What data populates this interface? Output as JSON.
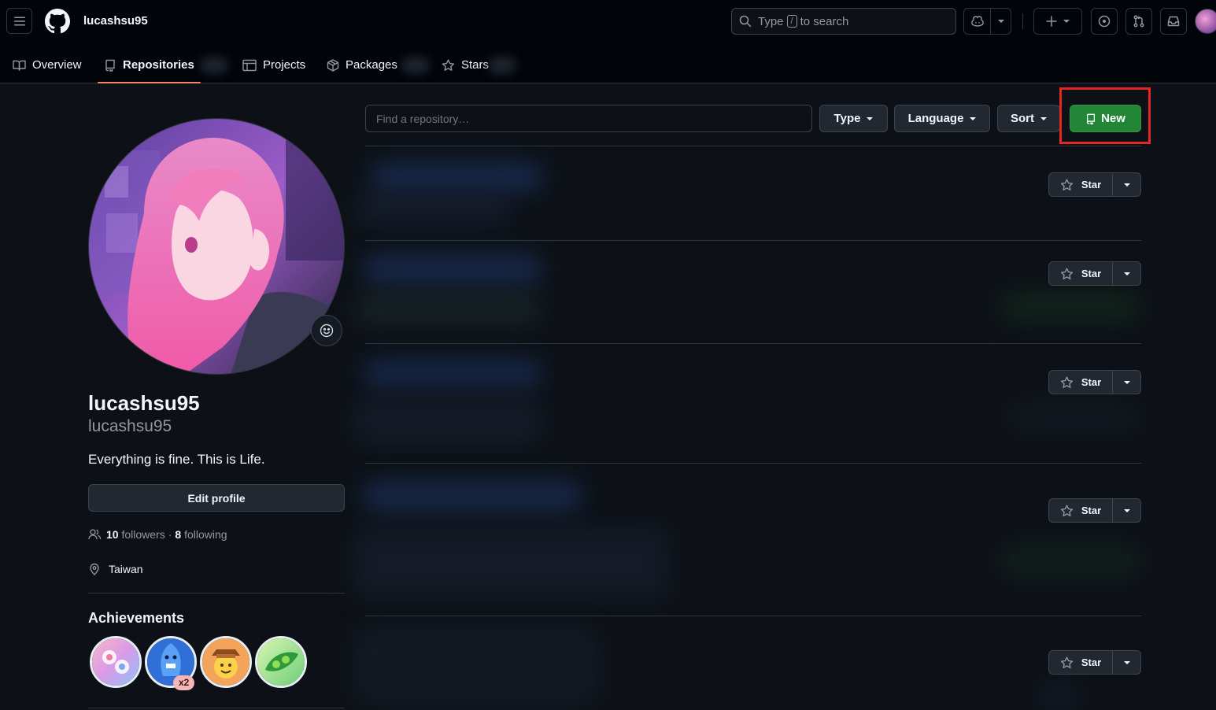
{
  "header": {
    "context_name": "lucashsu95",
    "search": {
      "prefix": "Type",
      "key": "/",
      "suffix": "to search"
    }
  },
  "tabs": [
    {
      "label": "Overview",
      "icon": "book-icon"
    },
    {
      "label": "Repositories",
      "icon": "repo-icon",
      "selected": true
    },
    {
      "label": "Projects",
      "icon": "table-icon"
    },
    {
      "label": "Packages",
      "icon": "package-icon"
    },
    {
      "label": "Stars",
      "icon": "star-icon"
    }
  ],
  "profile": {
    "name": "lucashsu95",
    "login": "lucashsu95",
    "bio": "Everything is fine. This is Life.",
    "edit_label": "Edit profile",
    "followers_count": "10",
    "followers_label": "followers",
    "separator": "·",
    "following_count": "8",
    "following_label": "following",
    "location": "Taiwan",
    "achievements_title": "Achievements",
    "achievements": [
      {
        "name": "YOLO"
      },
      {
        "name": "Pull Shark",
        "multiplier": "x2"
      },
      {
        "name": "Quickdraw"
      },
      {
        "name": "Pair Extraordinaire"
      }
    ]
  },
  "repo_filters": {
    "find_placeholder": "Find a repository…",
    "type_label": "Type",
    "language_label": "Language",
    "sort_label": "Sort",
    "new_label": "New"
  },
  "repos": [
    {
      "star_label": "Star"
    },
    {
      "star_label": "Star"
    },
    {
      "star_label": "Star"
    },
    {
      "star_label": "Star"
    },
    {
      "star_label": "Star"
    }
  ],
  "colors": {
    "background": "#0d1117",
    "header": "#010409",
    "accent_tab": "#f78166",
    "new_button": "#238636",
    "highlight_box": "#e0281e"
  }
}
